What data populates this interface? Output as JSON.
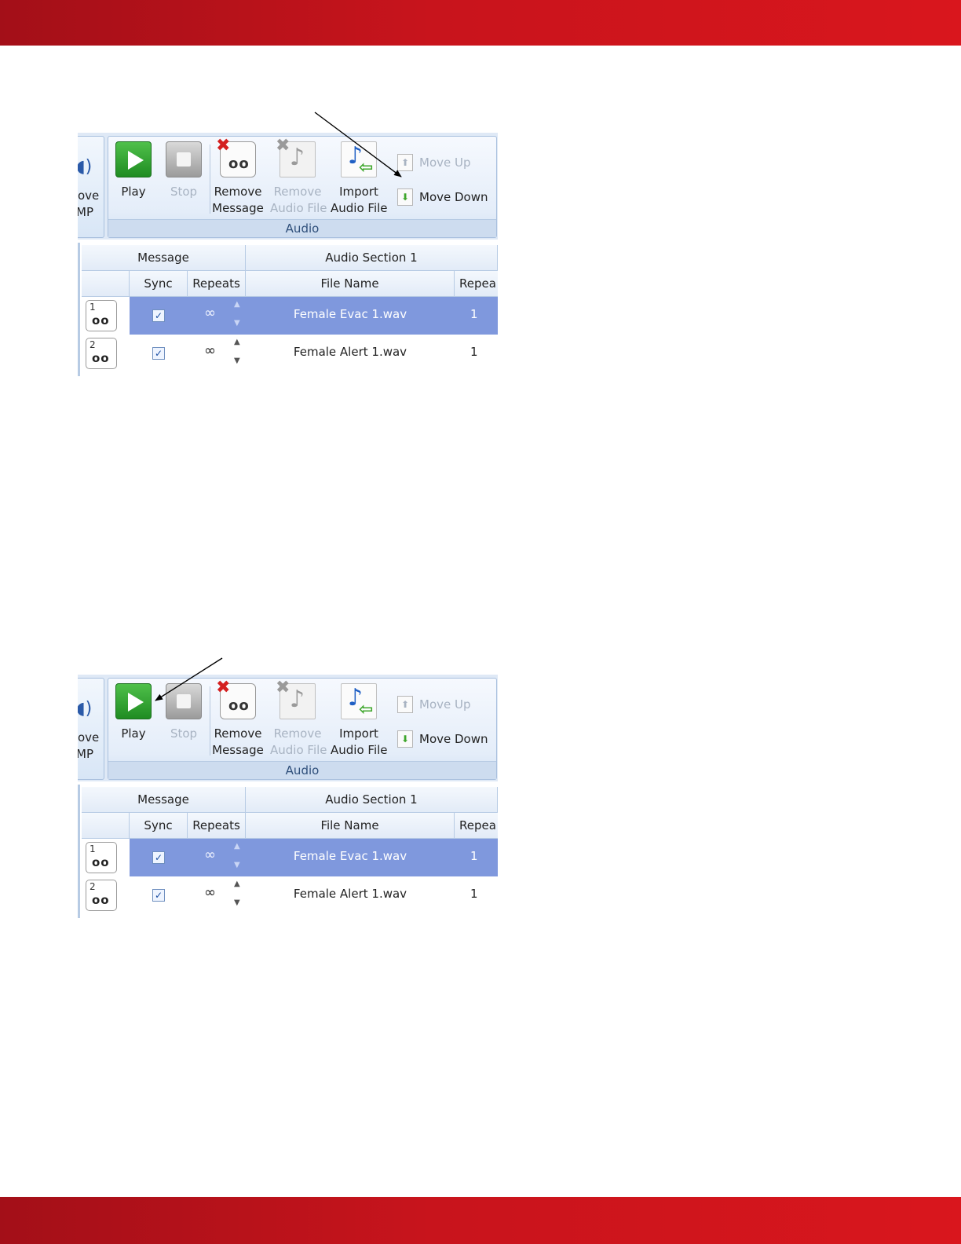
{
  "left_group": {
    "label_line1": "ove",
    "label_line2": "MP"
  },
  "ribbon": {
    "group_caption": "Audio",
    "play": {
      "label": "Play"
    },
    "stop": {
      "label": "Stop"
    },
    "remove_message": {
      "line1": "Remove",
      "line2": "Message"
    },
    "remove_audio_file": {
      "line1": "Remove",
      "line2": "Audio File"
    },
    "import_audio_file": {
      "line1": "Import",
      "line2": "Audio File"
    },
    "move_up": {
      "label": "Move Up"
    },
    "move_down": {
      "label": "Move Down"
    }
  },
  "grid": {
    "header_message": "Message",
    "header_section": "Audio Section 1",
    "col_sync": "Sync",
    "col_repeats": "Repeats",
    "col_file_name": "File Name",
    "col_repeats_clipped": "Repea",
    "rows": [
      {
        "number": "1",
        "sync": "✓",
        "repeats": "∞",
        "file_name": "Female Evac 1.wav",
        "file_repeats": "1",
        "selected": true
      },
      {
        "number": "2",
        "sync": "✓",
        "repeats": "∞",
        "file_name": "Female Alert 1.wav",
        "file_repeats": "1",
        "selected": false
      }
    ]
  },
  "icons": {
    "speaker": "speaker-icon",
    "play": "play-icon",
    "stop": "stop-icon",
    "remove_message": "remove-message-icon",
    "remove_audio": "remove-audio-file-icon",
    "import": "import-audio-file-icon",
    "move_up": "move-up-icon",
    "move_down": "move-down-icon",
    "voicemail": "voicemail-icon"
  },
  "colors": {
    "brand_band": "#c8141c",
    "selected_row": "#7f98dd",
    "ribbon_bg": "#dfe9f6"
  }
}
